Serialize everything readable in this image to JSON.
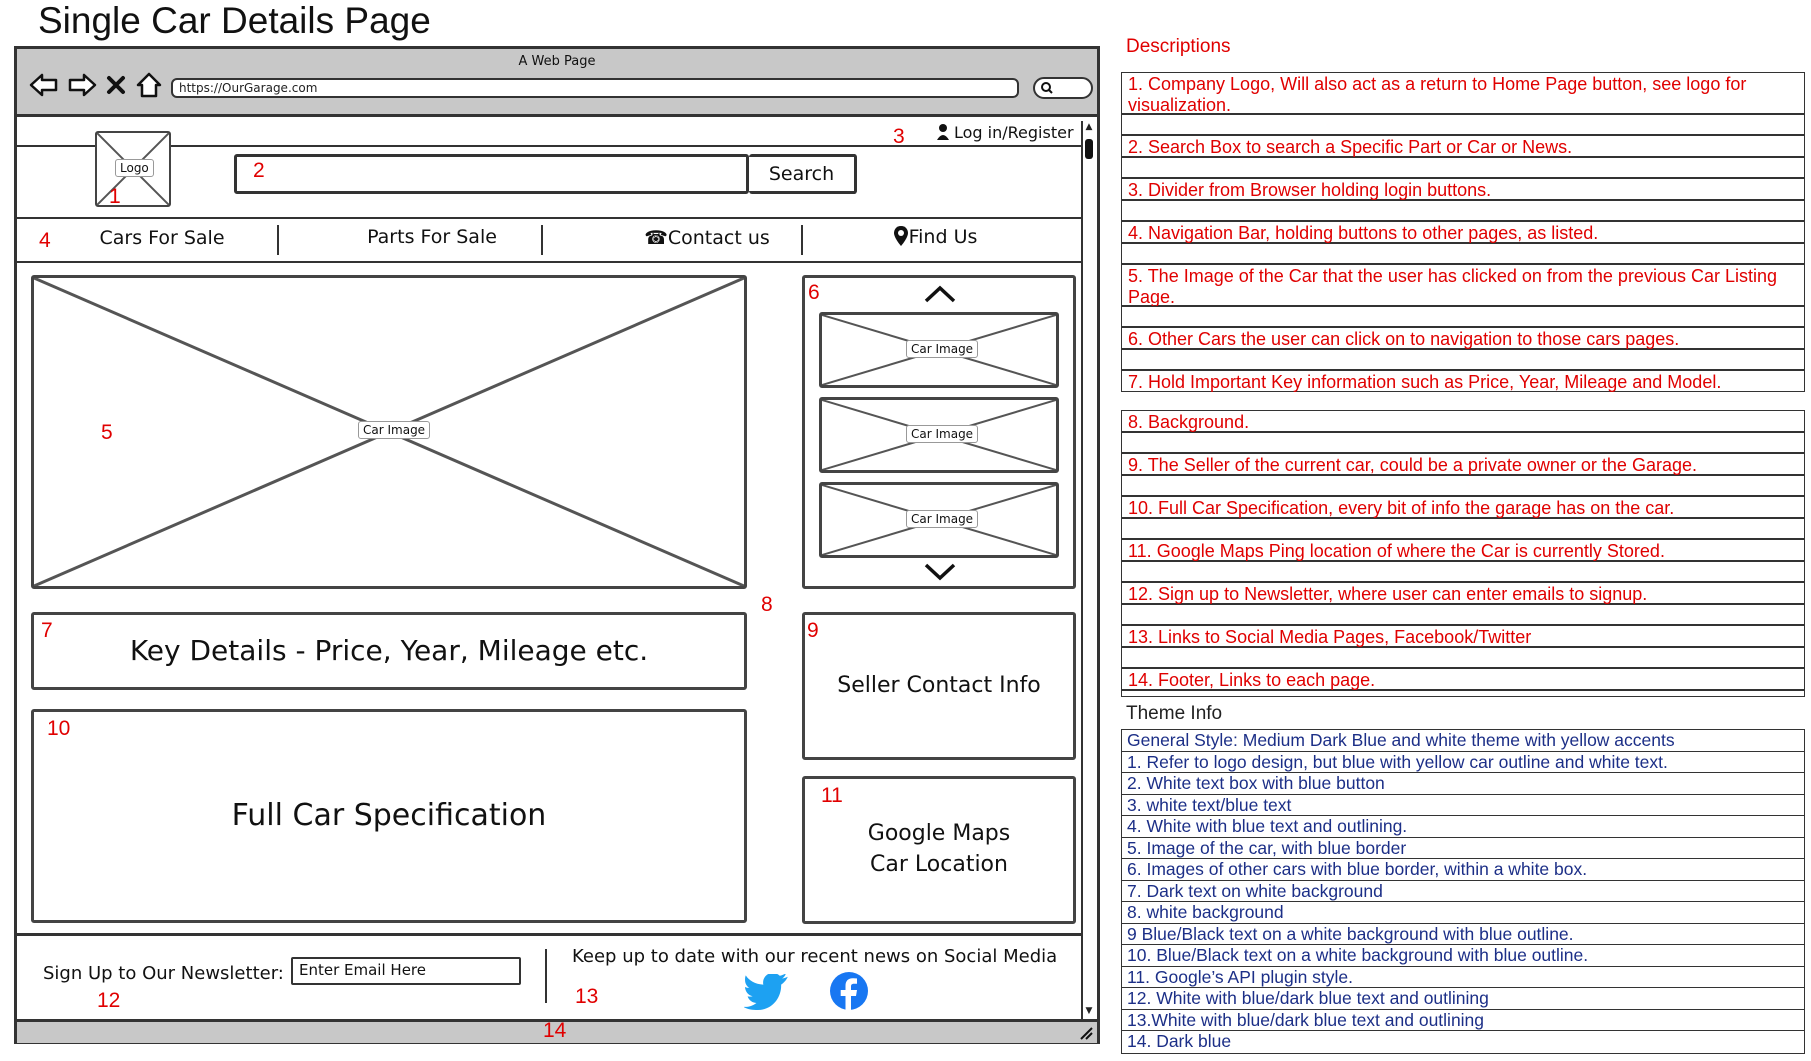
{
  "page_title": "Single Car Details Page",
  "browser": {
    "window_title": "A Web Page",
    "url": "https://OurGarage.com"
  },
  "header": {
    "login_label": "Log in/Register",
    "logo_label": "Logo",
    "search_button": "Search"
  },
  "nav": {
    "items": [
      "Cars For Sale",
      "Parts For Sale",
      "Contact us",
      "Find Us"
    ]
  },
  "main": {
    "car_image_label": "Car Image",
    "thumb_label": "Car Image",
    "key_details": "Key Details - Price, Year, Mileage etc.",
    "full_spec": "Full Car Specification",
    "seller_info": "Seller Contact Info",
    "maps_line1": "Google Maps",
    "maps_line2": "Car Location"
  },
  "footer": {
    "newsletter_label": "Sign Up to Our Newsletter:",
    "email_placeholder": "Enter Email Here",
    "social_text": "Keep up to date with our recent news on Social Media"
  },
  "markers": [
    "1",
    "2",
    "3",
    "4",
    "5",
    "6",
    "7",
    "8",
    "9",
    "10",
    "11",
    "12",
    "13",
    "14"
  ],
  "descriptions": {
    "heading": "Descriptions",
    "items": [
      "1. Company Logo, Will also act as a return to Home Page button, see logo for visualization.",
      "2. Search Box to search a Specific Part or Car or News.",
      "3. Divider from Browser holding login buttons.",
      "4. Navigation Bar, holding buttons to other pages, as listed.",
      "5. The Image of the Car that the user has clicked on from the previous Car Listing Page.",
      "6. Other Cars the user can click on to navigation to those cars pages.",
      "7. Hold Important Key information such as Price, Year, Mileage and Model.",
      "8. Background.",
      "9. The Seller of the current car, could be a private owner or the Garage.",
      "10. Full Car Specification, every bit of info the garage has on the car.",
      "11. Google Maps Ping location of where the Car is currently Stored.",
      "12. Sign up to Newsletter, where user can enter emails to signup.",
      "13. Links to Social Media Pages, Facebook/Twitter",
      "14. Footer, Links to each page."
    ]
  },
  "theme": {
    "heading": "Theme Info",
    "items": [
      "General Style: Medium Dark Blue and white theme with yellow accents",
      "1. Refer to logo design, but blue with yellow car outline and white text.",
      "2. White text box with blue button",
      "3. white text/blue text",
      "4. White with blue text and outlining.",
      "5. Image of the car, with blue border",
      "6. Images of other cars with blue border, within a white box.",
      "7. Dark text on white background",
      "8. white background",
      "9 Blue/Black text on a white background with blue outline.",
      "10. Blue/Black text on a white background with blue outline.",
      "11. Google’s API plugin style.",
      "12. White with blue/dark blue text and outlining",
      "13.White with blue/dark blue text and outlining",
      "14. Dark blue"
    ]
  },
  "colors": {
    "annotation_red": "#e00000",
    "theme_blue": "#1c2f87",
    "chrome_gray": "#c8c8c8",
    "twitter_blue": "#1da1f2",
    "facebook_blue": "#1877f2"
  }
}
